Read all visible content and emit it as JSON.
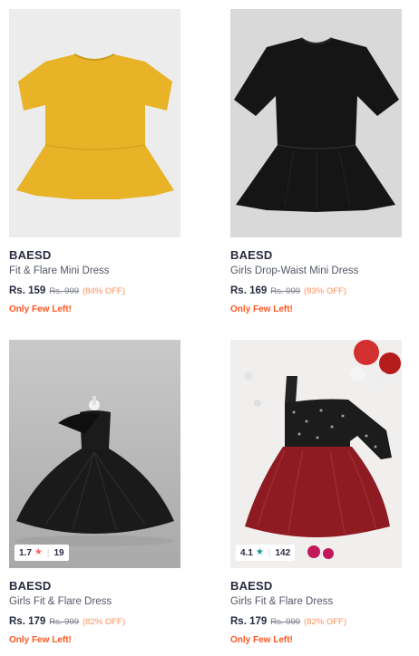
{
  "products": [
    {
      "brand": "BAESD",
      "name": "Fit & Flare Mini Dress",
      "price": "Rs. 159",
      "mrp": "Rs. 999",
      "discount": "(84% OFF)",
      "stock": "Only Few Left!",
      "rating": null,
      "image": {
        "bg": "#ececec",
        "dress": "#e8b326"
      }
    },
    {
      "brand": "BAESD",
      "name": "Girls Drop-Waist Mini Dress",
      "price": "Rs. 169",
      "mrp": "Rs. 999",
      "discount": "(83% OFF)",
      "stock": "Only Few Left!",
      "rating": null,
      "image": {
        "bg": "#d9d9d9",
        "dress": "#151515"
      }
    },
    {
      "brand": "BAESD",
      "name": "Girls Fit & Flare Dress",
      "price": "Rs. 179",
      "mrp": "Rs. 999",
      "discount": "(82% OFF)",
      "stock": "Only Few Left!",
      "rating": {
        "score": "1.7",
        "count": "19",
        "star_color": "#ff6161"
      },
      "image": {
        "bg": "#bdbdbd",
        "dress": "#1a1a1a"
      }
    },
    {
      "brand": "BAESD",
      "name": "Girls Fit & Flare Dress",
      "price": "Rs. 179",
      "mrp": "Rs. 999",
      "discount": "(82% OFF)",
      "stock": "Only Few Left!",
      "rating": {
        "score": "4.1",
        "count": "142",
        "star_color": "#14958f"
      },
      "image": {
        "bg": "#f1efee",
        "dress": "#8e1b22"
      }
    }
  ],
  "colors": {
    "brand_text": "#282c3f",
    "name_text": "#535766",
    "discount": "#ff905a",
    "stock_alert": "#ff5722"
  }
}
